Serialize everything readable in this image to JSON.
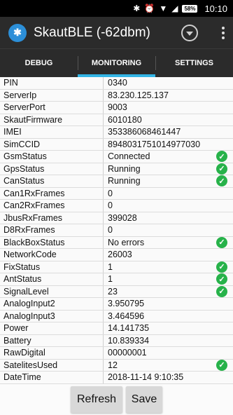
{
  "status_bar": {
    "battery": "58%",
    "time": "10:10",
    "icons": [
      "bluetooth-icon",
      "alarm-icon",
      "wifi-icon",
      "signal-icon",
      "battery-icon"
    ]
  },
  "appbar": {
    "title": "SkautBLE (-62dbm)",
    "logo_icon": "bluetooth-icon"
  },
  "tabs": [
    {
      "label": "DEBUG",
      "active": false
    },
    {
      "label": "MONITORING",
      "active": true
    },
    {
      "label": "SETTINGS",
      "active": false
    }
  ],
  "rows": [
    {
      "key": "PIN",
      "value": "0340",
      "ok": false
    },
    {
      "key": "ServerIp",
      "value": "83.230.125.137",
      "ok": false
    },
    {
      "key": "ServerPort",
      "value": "9003",
      "ok": false
    },
    {
      "key": "SkautFirmware",
      "value": "6010180",
      "ok": false
    },
    {
      "key": "IMEI",
      "value": "353386068461447",
      "ok": false
    },
    {
      "key": "SimCCID",
      "value": "8948031751014977030",
      "ok": false
    },
    {
      "key": "GsmStatus",
      "value": "Connected",
      "ok": true
    },
    {
      "key": "GpsStatus",
      "value": "Running",
      "ok": true
    },
    {
      "key": "CanStatus",
      "value": "Running",
      "ok": true
    },
    {
      "key": "Can1RxFrames",
      "value": "0",
      "ok": false
    },
    {
      "key": "Can2RxFrames",
      "value": "0",
      "ok": false
    },
    {
      "key": "JbusRxFrames",
      "value": "399028",
      "ok": false
    },
    {
      "key": "D8RxFrames",
      "value": "0",
      "ok": false
    },
    {
      "key": "BlackBoxStatus",
      "value": "No errors",
      "ok": true
    },
    {
      "key": "NetworkCode",
      "value": "26003",
      "ok": false
    },
    {
      "key": "FixStatus",
      "value": "1",
      "ok": true
    },
    {
      "key": "AntStatus",
      "value": "1",
      "ok": true
    },
    {
      "key": "SignalLevel",
      "value": "23",
      "ok": true
    },
    {
      "key": "AnalogInput2",
      "value": "3.950795",
      "ok": false
    },
    {
      "key": "AnalogInput3",
      "value": "3.464596",
      "ok": false
    },
    {
      "key": "Power",
      "value": "14.141735",
      "ok": false
    },
    {
      "key": "Battery",
      "value": "10.839334",
      "ok": false
    },
    {
      "key": "RawDigital",
      "value": "00000001",
      "ok": false
    },
    {
      "key": "SatelitesUsed",
      "value": "12",
      "ok": true
    },
    {
      "key": "DateTime",
      "value": "2018-11-14 9:10:35",
      "ok": false
    }
  ],
  "buttons": {
    "refresh": "Refresh",
    "save": "Save"
  },
  "colors": {
    "accent": "#33b5e5",
    "ok_green": "#27b24a",
    "appbar": "#2b2b2b"
  }
}
